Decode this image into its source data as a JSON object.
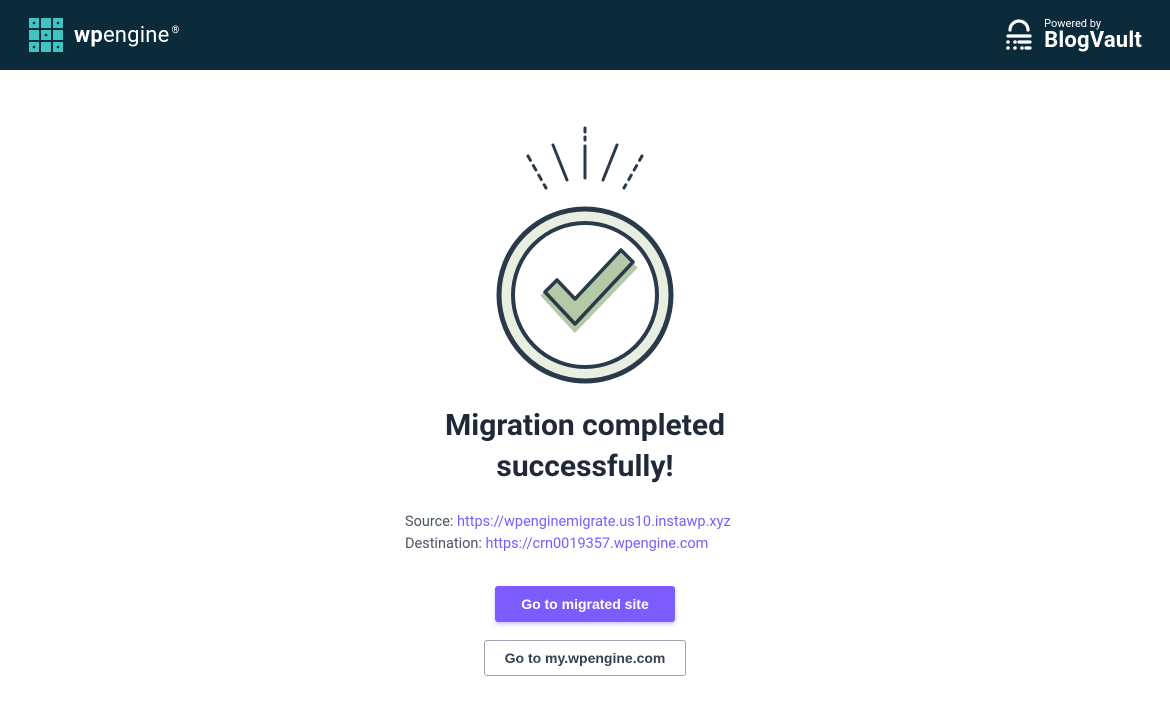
{
  "header": {
    "brand_bold": "wp",
    "brand_rest": "engine",
    "powered_by_label": "Powered by",
    "blogvault_label": "BlogVault"
  },
  "main": {
    "title_line1": "Migration completed",
    "title_line2": "successfully!",
    "source_label": "Source: ",
    "source_url": "https://wpenginemigrate.us10.instawp.xyz",
    "destination_label": "Destination: ",
    "destination_url": "https://crn0019357.wpengine.com",
    "primary_button": "Go to migrated site",
    "secondary_button": "Go to my.wpengine.com"
  }
}
